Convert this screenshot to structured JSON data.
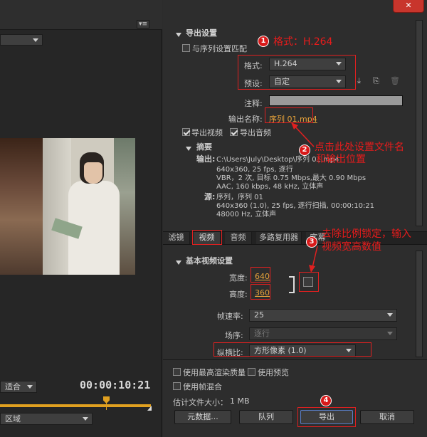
{
  "export_settings": {
    "title": "导出设置",
    "match_sequence_label": "与序列设置匹配",
    "format_label": "格式:",
    "format_value": "H.264",
    "preset_label": "预设:",
    "preset_value": "自定",
    "comment_label": "注释:",
    "output_name_label": "输出名称:",
    "output_name_value": "序列 01.mp4",
    "export_video_label": "导出视频",
    "export_audio_label": "导出音频"
  },
  "summary": {
    "title": "摘要",
    "output_label": "输出:",
    "output_lines": [
      "C:\\Users\\July\\Desktop\\序列 01.mp4",
      "640x360, 25 fps, 逐行",
      "VBR，2 次, 目标 0.75 Mbps,最大 0.90 Mbps",
      "AAC, 160 kbps, 48 kHz, 立体声"
    ],
    "source_label": "源:",
    "source_lines": [
      "序列，序列 01",
      "640x360 (1.0), 25 fps, 逐行扫描, 00:00:10:21",
      "48000 Hz, 立体声"
    ]
  },
  "tabs": [
    "滤镜",
    "视频",
    "音频",
    "多路复用器",
    "字幕"
  ],
  "basic_video": {
    "title": "基本视频设置",
    "width_label": "宽度:",
    "width_value": "640",
    "height_label": "高度:",
    "height_value": "360",
    "frame_rate_label": "帧速率:",
    "frame_rate_value": "25",
    "field_order_label": "场序:",
    "field_order_value": "逐行",
    "aspect_label": "纵横比:",
    "aspect_value": "方形像素 (1.0)"
  },
  "bottom": {
    "max_render_label": "使用最高渲染质量",
    "use_preview_label": "使用预览",
    "use_blending_label": "使用帧混合",
    "file_size_label": "估计文件大小：",
    "file_size_value": "1 MB",
    "metadata_button": "元数据...",
    "queue_button": "队列",
    "export_button": "导出",
    "cancel_button": "取消"
  },
  "left_panel": {
    "fit_value": "适合",
    "timecode": "00:00:10:21",
    "region_value": "区域"
  },
  "annotations": {
    "a1_number": "1",
    "a1_text": "格式：H.264",
    "a2_number": "2",
    "a2_text_line1": "点击此处设置文件名",
    "a2_text_line2": "和输出位置",
    "a3_number": "3",
    "a3_text_line1": "去除比例锁定，输入",
    "a3_text_line2": "视频宽高数值",
    "a4_number": "4"
  },
  "window_controls": {
    "close_symbol": "✕"
  },
  "colors": {
    "accent_red": "#e02020",
    "value_orange": "#e8a33a"
  }
}
